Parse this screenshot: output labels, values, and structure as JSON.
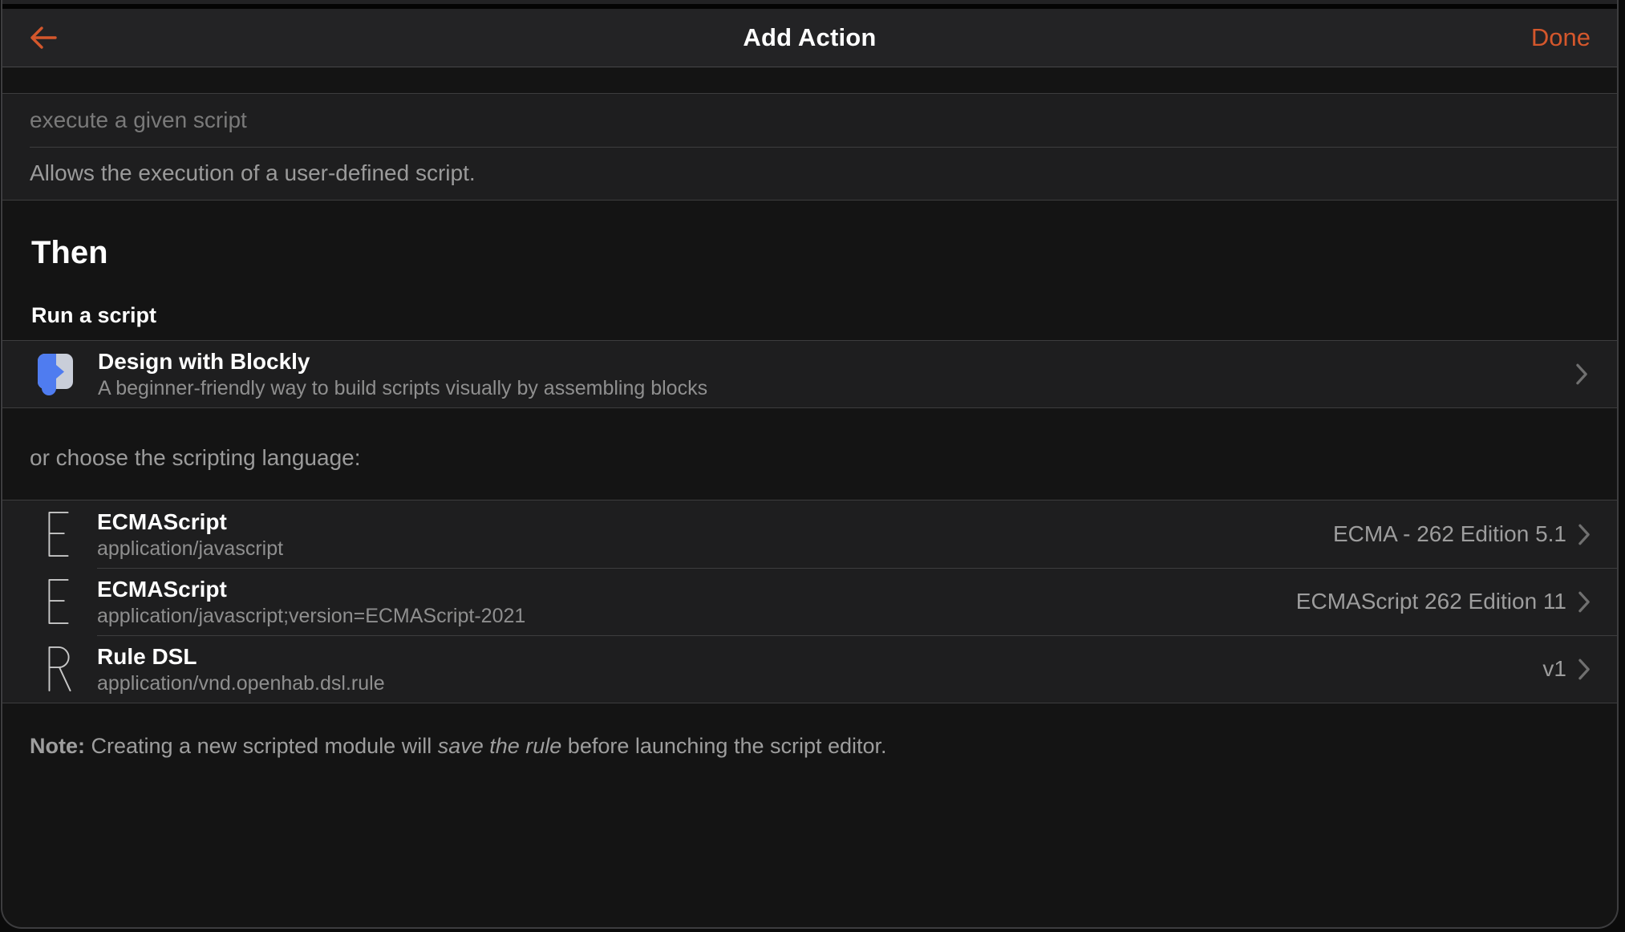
{
  "accent_color": "#d4572c",
  "navbar": {
    "title": "Add Action",
    "back_icon": "back-arrow-icon",
    "done_label": "Done"
  },
  "module": {
    "title_value": "execute a given script",
    "description": "Allows the execution of a user-defined script."
  },
  "then_heading": "Then",
  "run_script_heading": "Run a script",
  "blockly": {
    "title": "Design with Blockly",
    "subtitle": "A beginner-friendly way to build scripts visually by assembling blocks",
    "icon_blue": "#4f7cf0",
    "icon_light": "#c9ced9"
  },
  "or_choose_label": "or choose the scripting language:",
  "languages": [
    {
      "letter": "E",
      "title": "ECMAScript",
      "mime": "application/javascript",
      "version": "ECMA - 262 Edition 5.1"
    },
    {
      "letter": "E",
      "title": "ECMAScript",
      "mime": "application/javascript;version=ECMAScript-2021",
      "version": "ECMAScript 262 Edition 11"
    },
    {
      "letter": "R",
      "title": "Rule DSL",
      "mime": "application/vnd.openhab.dsl.rule",
      "version": "v1"
    }
  ],
  "note": {
    "prefix": "Note:",
    "body_start": " Creating a new scripted module will ",
    "italic": "save the rule",
    "body_end": " before launching the script editor."
  }
}
